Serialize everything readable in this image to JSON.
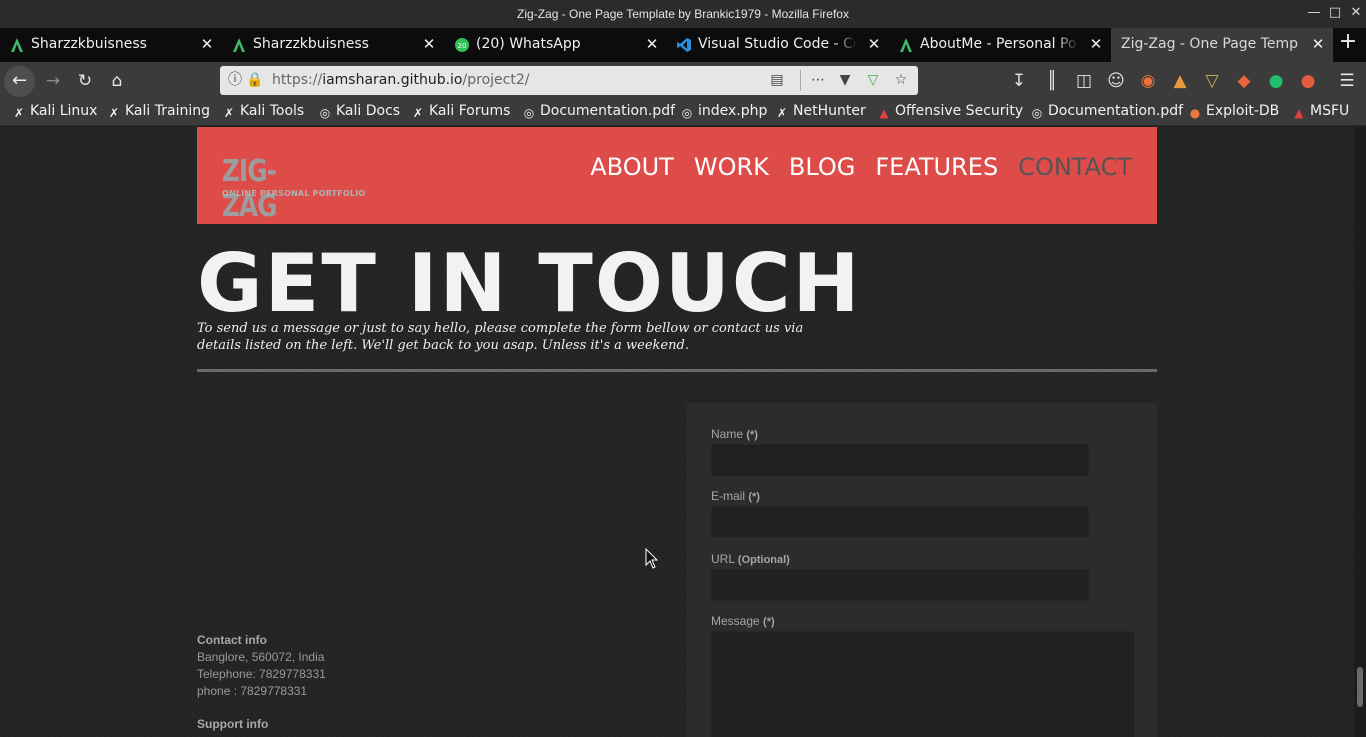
{
  "window": {
    "title": "Zig-Zag - One Page Template by Brankic1979 - Mozilla Firefox",
    "controls": [
      "minimize",
      "maximize",
      "close"
    ]
  },
  "tabs": [
    {
      "label": "Sharzzkbuisness",
      "icon": "green-a-icon"
    },
    {
      "label": "Sharzzkbuisness",
      "icon": "green-a-icon"
    },
    {
      "label": "(20) WhatsApp",
      "icon": "whatsapp-icon"
    },
    {
      "label": "Visual Studio Code - Cod",
      "icon": "vscode-icon"
    },
    {
      "label": "AboutMe - Personal Port",
      "icon": "green-a-icon"
    },
    {
      "label": "Zig-Zag - One Page Templa",
      "icon": "none",
      "active": true
    }
  ],
  "url": {
    "prefix": "https://",
    "host": "iamsharan.github.io",
    "path": "/project2/"
  },
  "bookmarks": [
    {
      "label": "Kali Linux",
      "icon": "kali-dragon-icon"
    },
    {
      "label": "Kali Training",
      "icon": "kali-dragon-icon"
    },
    {
      "label": "Kali Tools",
      "icon": "kali-dragon-icon"
    },
    {
      "label": "Kali Docs",
      "icon": "globe-icon"
    },
    {
      "label": "Kali Forums",
      "icon": "kali-dragon-icon"
    },
    {
      "label": "Documentation.pdf",
      "icon": "globe-icon"
    },
    {
      "label": "index.php",
      "icon": "globe-icon"
    },
    {
      "label": "NetHunter",
      "icon": "kali-dragon-icon"
    },
    {
      "label": "Offensive Security",
      "icon": "offsec-icon"
    },
    {
      "label": "Documentation.pdf",
      "icon": "globe-icon"
    },
    {
      "label": "Exploit-DB",
      "icon": "exploitdb-icon"
    },
    {
      "label": "MSFU",
      "icon": "offsec-icon"
    }
  ],
  "site": {
    "logo": {
      "mark": "ZIG-ZAG",
      "sub": "ONLINE PERSONAL PORTFOLIO"
    },
    "nav": [
      "ABOUT",
      "WORK",
      "BLOG",
      "FEATURES",
      "CONTACT"
    ],
    "nav_current": "CONTACT",
    "heading": "GET IN TOUCH",
    "intro": "To send us a message or just to say hello, please complete the form bellow or contact us via details listed on the left. We'll get back to you asap. Unless it's a weekend.",
    "contact": {
      "heading": "Contact info",
      "address": "Banglore, 560072, India",
      "telephone": "Telephone: 7829778331",
      "phone": "phone : 7829778331"
    },
    "support_heading": "Support info",
    "form": {
      "name_label": "Name",
      "name_req": "(*)",
      "email_label": "E-mail",
      "email_req": "(*)",
      "url_label": "URL",
      "url_opt": "(Optional)",
      "message_label": "Message",
      "message_req": "(*)"
    }
  },
  "colors": {
    "header_red": "#dd4c48",
    "page_bg": "#232323",
    "form_bg": "#2c2c2c"
  }
}
